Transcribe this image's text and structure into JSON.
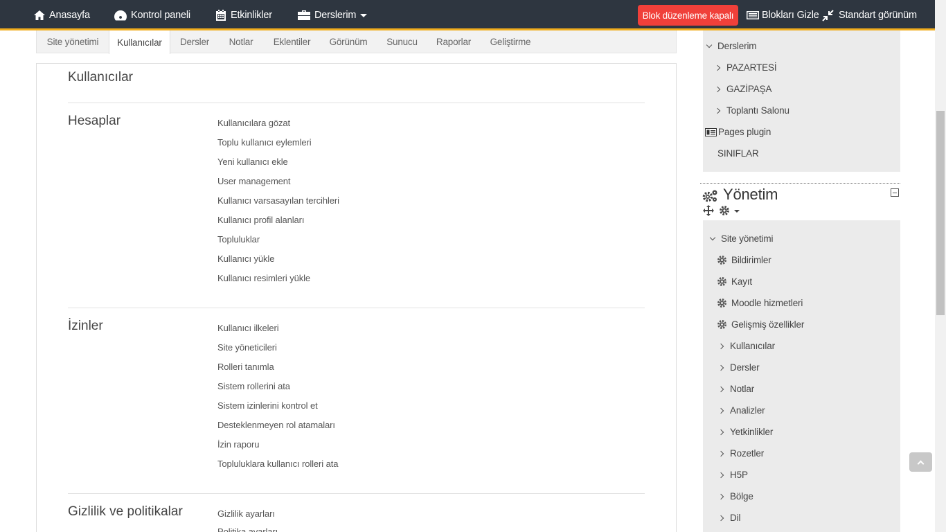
{
  "navbar": {
    "home": "Anasayfa",
    "dashboard": "Kontrol paneli",
    "events": "Etkinlikler",
    "my_courses": "Derslerim",
    "edit_blocks": "Blok düzenleme kapalı",
    "hide_blocks": "Blokları Gizle",
    "standard_view": "Standart görünüm"
  },
  "tabs": [
    "Site yönetimi",
    "Kullanıcılar",
    "Dersler",
    "Notlar",
    "Eklentiler",
    "Görünüm",
    "Sunucu",
    "Raporlar",
    "Geliştirme"
  ],
  "page_title": "Kullanıcılar",
  "sections": [
    {
      "title": "Hesaplar",
      "links": [
        "Kullanıcılara gözat",
        "Toplu kullanıcı eylemleri",
        "Yeni kullanıcı ekle",
        "User management",
        "Kullanıcı varsasayılan tercihleri",
        "Kullanıcı profil alanları",
        "Topluluklar",
        "Kullanıcı yükle",
        "Kullanıcı resimleri yükle"
      ]
    },
    {
      "title": "İzinler",
      "links": [
        "Kullanıcı ilkeleri",
        "Site yöneticileri",
        "Rolleri tanımla",
        "Sistem rollerini ata",
        "Sistem izinlerini kontrol et",
        "Desteklenmeyen rol atamaları",
        "İzin raporu",
        "Topluluklara kullanıcı rolleri ata"
      ]
    },
    {
      "title": "Gizlilik ve politikalar",
      "links": [
        "Gizlilik ayarları",
        "Politika ayarları"
      ]
    }
  ],
  "nav_block": {
    "my_courses": "Derslerim",
    "courses": [
      "PAZARTESİ",
      "GAZİPAŞA",
      "Toplantı Salonu"
    ],
    "pages_plugin": "Pages plugin",
    "classes": "SINIFLAR"
  },
  "admin_block": {
    "title": "Yönetim",
    "root": "Site yönetimi",
    "gear_items": [
      "Bildirimler",
      "Kayıt",
      "Moodle hizmetleri",
      "Gelişmiş özellikler"
    ],
    "collapsed_items": [
      "Kullanıcılar",
      "Dersler",
      "Notlar",
      "Analizler",
      "Yetkinlikler",
      "Rozetler",
      "H5P",
      "Bölge",
      "Dil"
    ]
  }
}
